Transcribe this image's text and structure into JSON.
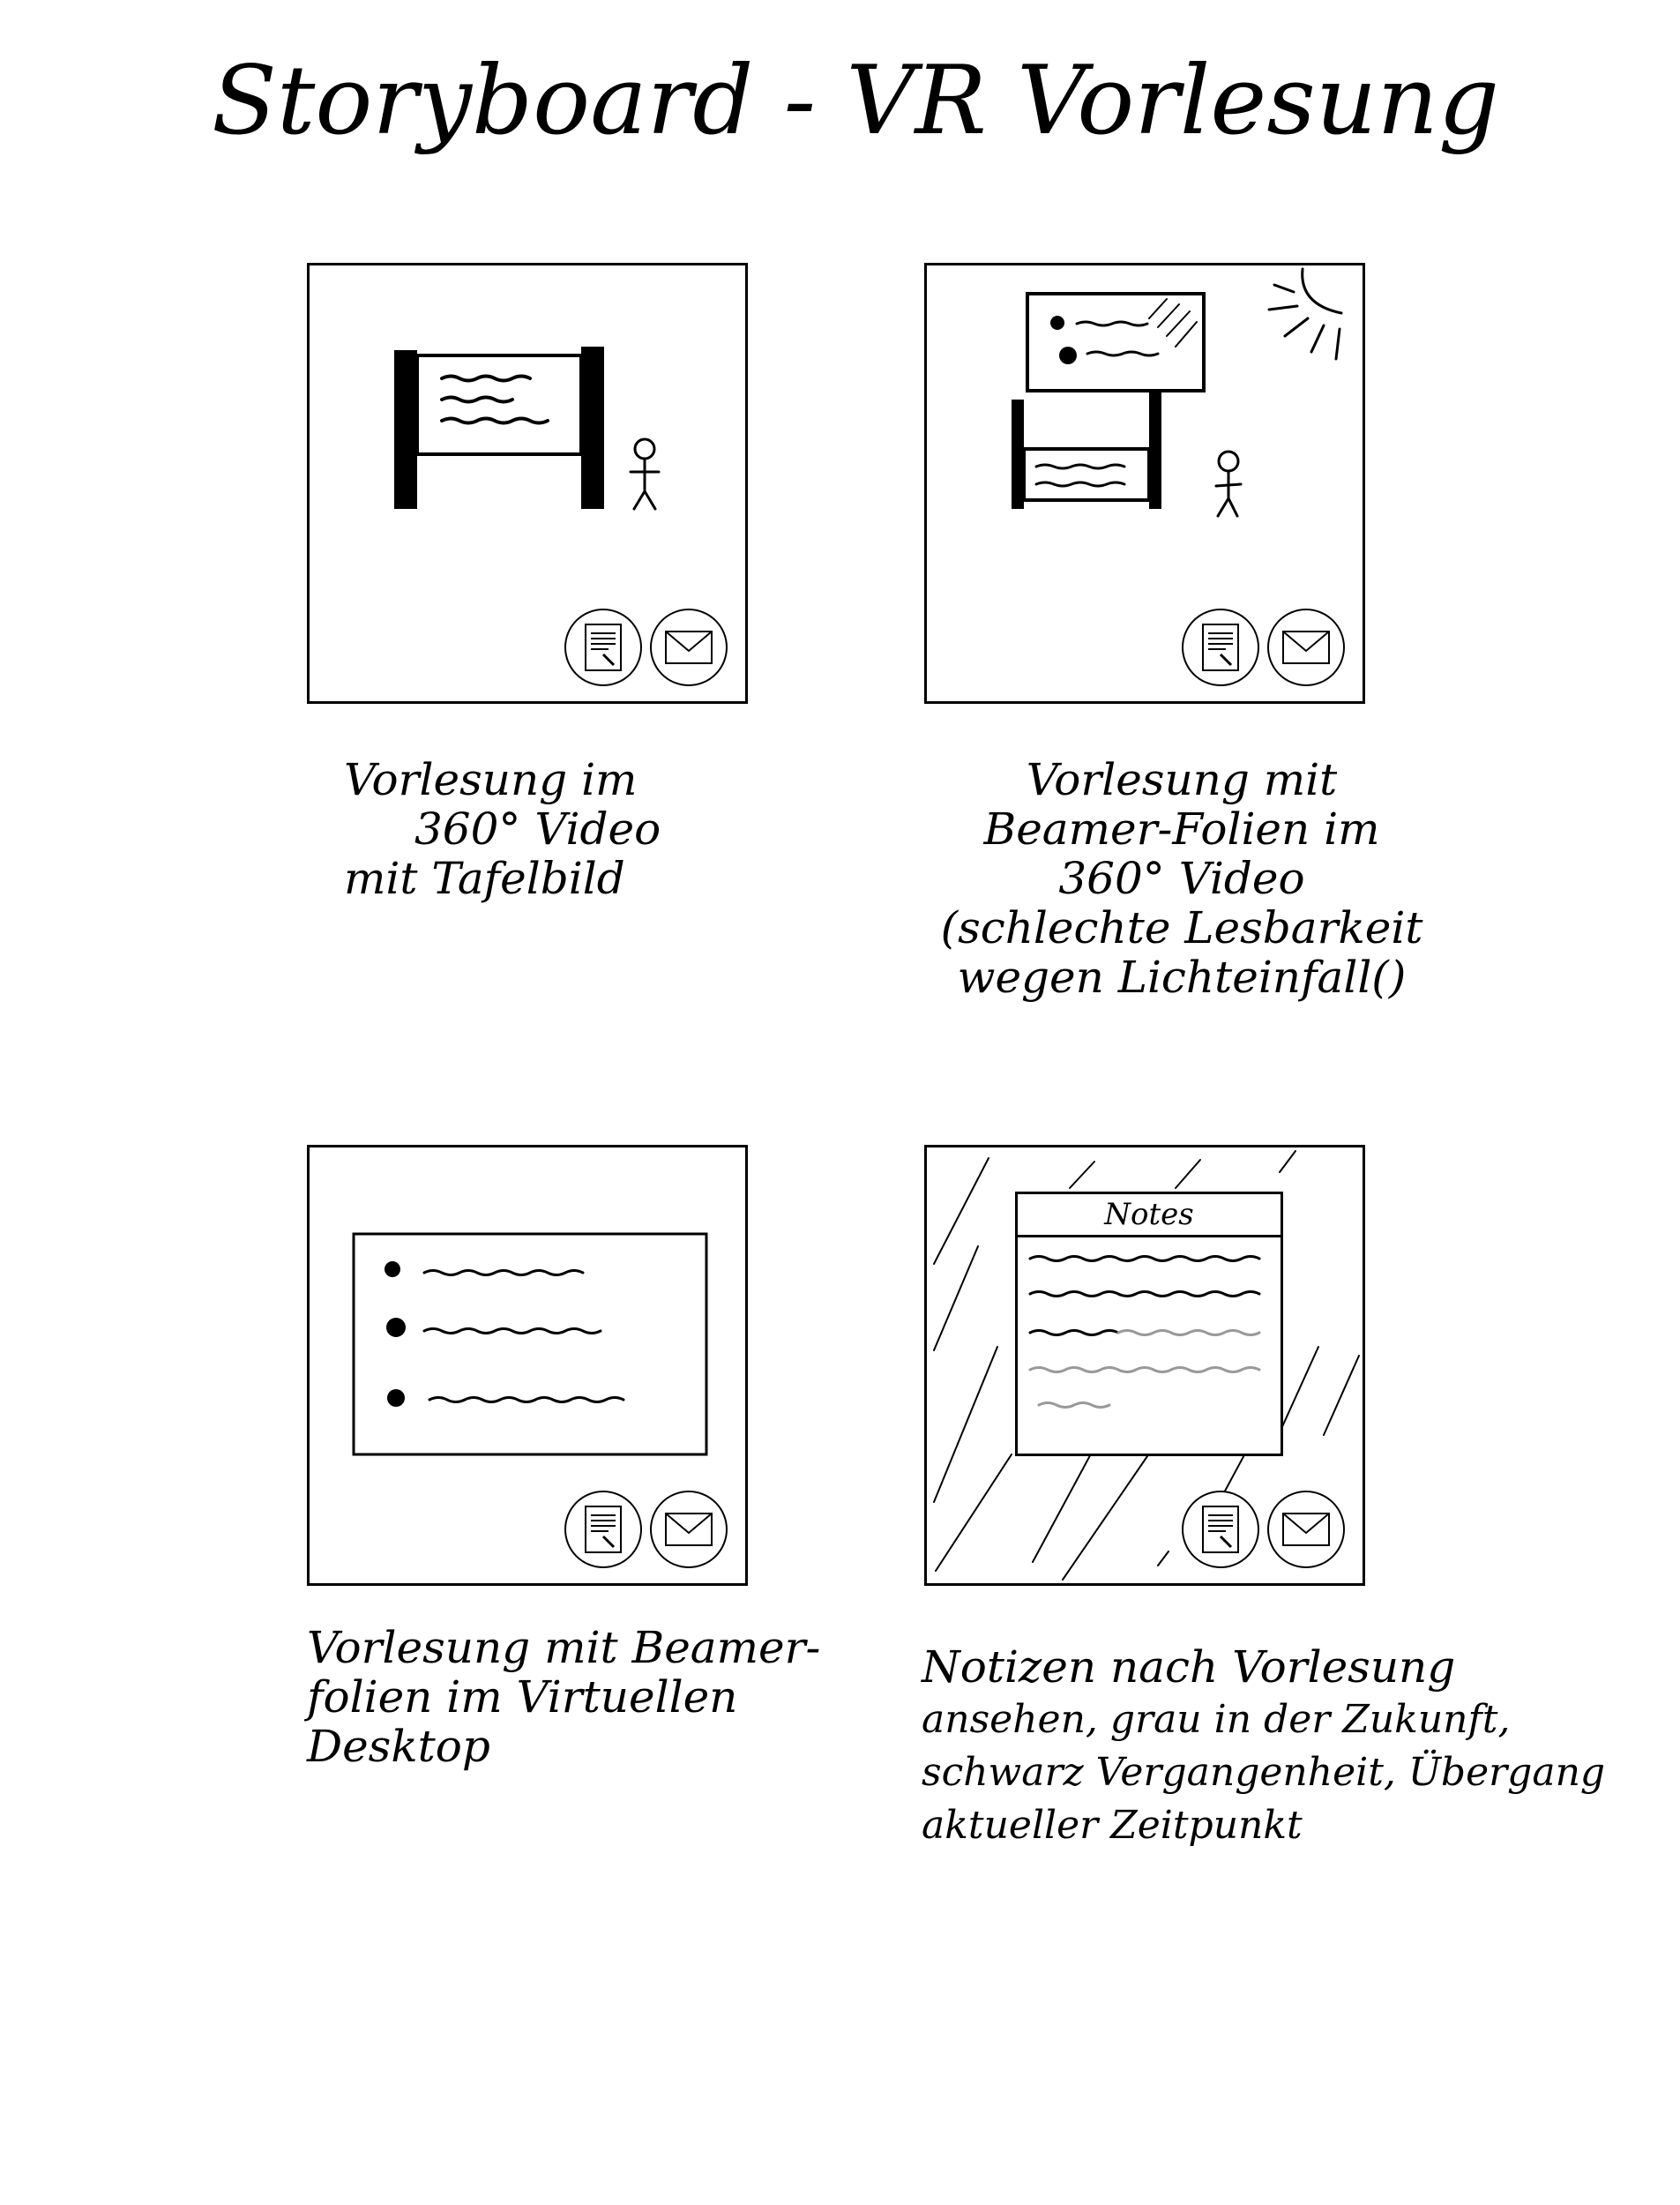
{
  "title": "Storyboard - VR Vorlesung",
  "panels": [
    {
      "caption_lines": [
        "Vorlesung im",
        "360° Video",
        "mit Tafelbild"
      ]
    },
    {
      "caption_lines": [
        "Vorlesung mit",
        "Beamer-Folien im",
        "360° Video",
        "(schlechte Lesbarkeit",
        "wegen Lichteinfall()"
      ]
    },
    {
      "caption_lines": [
        "Vorlesung mit Beamer-",
        "folien im Virtuellen",
        "Desktop"
      ]
    },
    {
      "notes_window_title": "Notes",
      "caption_lines": [
        "Notizen nach Vorlesung",
        "ansehen, grau in der Zukunft,",
        "schwarz Vergangenheit, Übergang",
        "aktueller Zeitpunkt"
      ]
    }
  ],
  "icons": {
    "notes": "notes-document-icon",
    "mail": "envelope-icon",
    "sun": "sun-icon",
    "person": "stick-figure-icon"
  },
  "colors": {
    "ink": "#000000",
    "past_text": "#000000",
    "future_text": "#999999"
  }
}
